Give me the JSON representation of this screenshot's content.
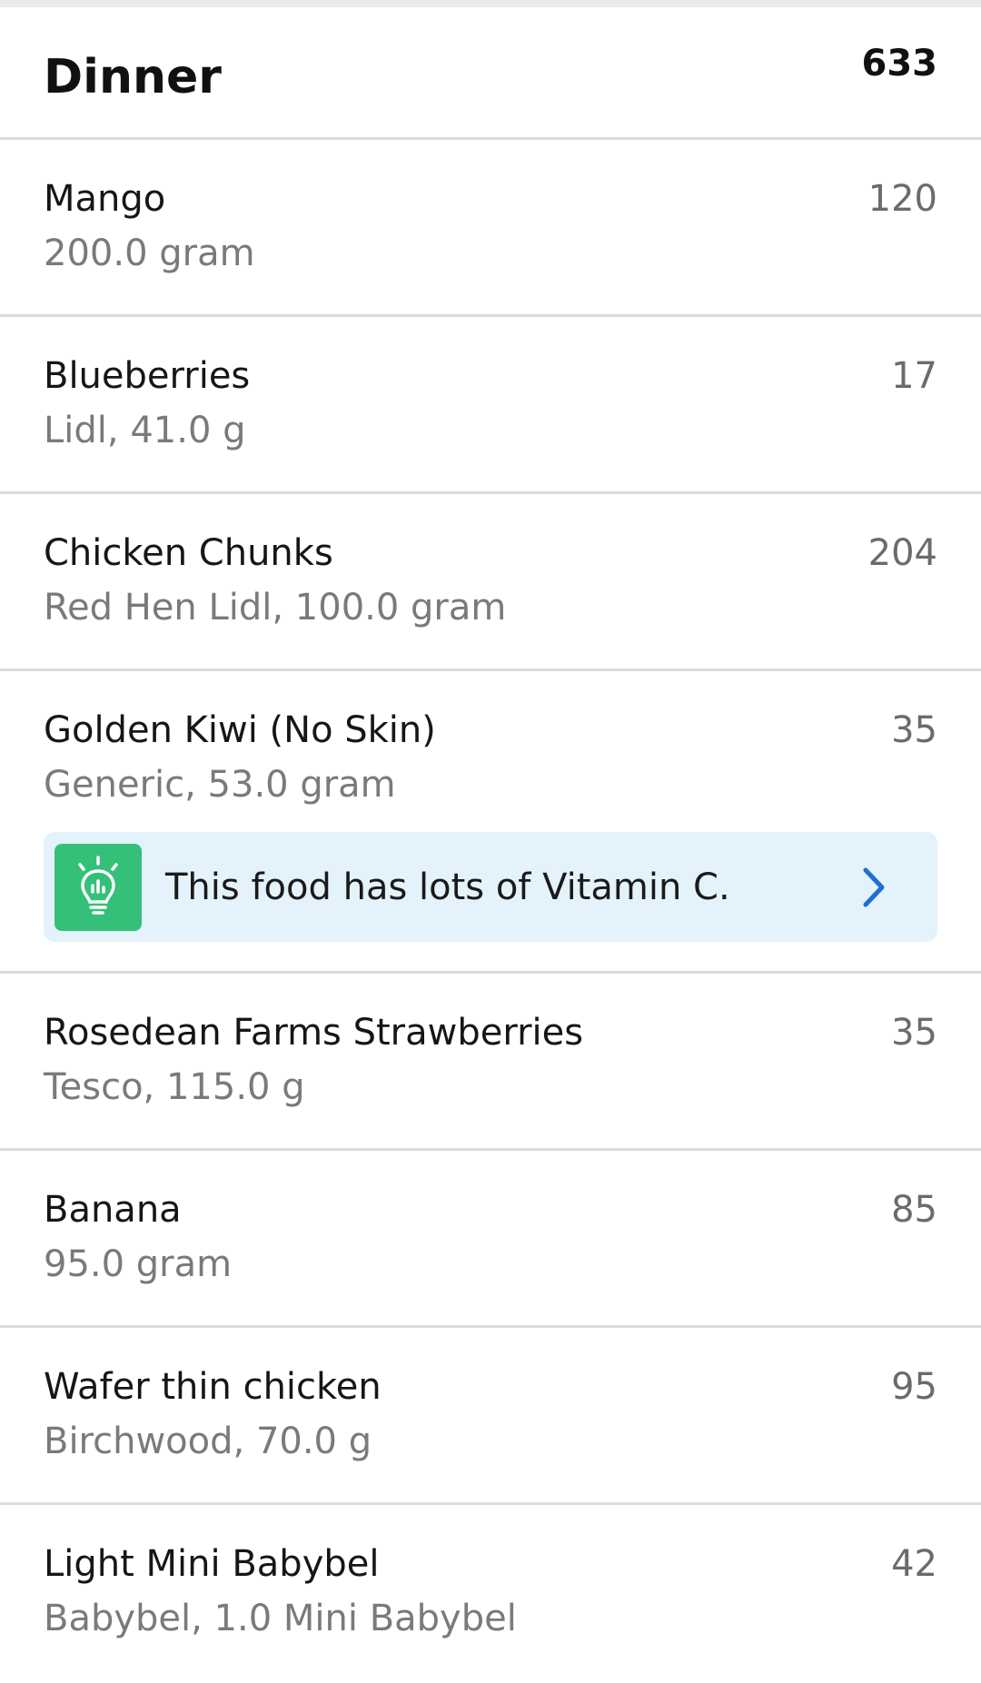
{
  "meal": {
    "title": "Dinner",
    "total_calories": "633"
  },
  "items": [
    {
      "name": "Mango",
      "detail": "200.0 gram",
      "calories": "120"
    },
    {
      "name": "Blueberries",
      "detail": "Lidl, 41.0 g",
      "calories": "17"
    },
    {
      "name": "Chicken Chunks",
      "detail": "Red Hen Lidl, 100.0 gram",
      "calories": "204"
    },
    {
      "name": "Golden Kiwi (No Skin)",
      "detail": "Generic, 53.0 gram",
      "calories": "35",
      "tip": {
        "text": "This food has lots of Vitamin C.",
        "icon": "lightbulb-icon",
        "chevron": "chevron-right-icon"
      }
    },
    {
      "name": "Rosedean Farms Strawberries",
      "detail": "Tesco, 115.0 g",
      "calories": "35"
    },
    {
      "name": "Banana",
      "detail": "95.0 gram",
      "calories": "85"
    },
    {
      "name": "Wafer thin chicken",
      "detail": "Birchwood, 70.0 g",
      "calories": "95"
    },
    {
      "name": "Light Mini Babybel",
      "detail": "Babybel, 1.0 Mini Babybel",
      "calories": "42"
    }
  ],
  "colors": {
    "tip_background": "#e4f2fb",
    "tip_icon_background": "#35c07a",
    "chevron": "#1f6fd1",
    "divider": "#dcdcdc"
  }
}
